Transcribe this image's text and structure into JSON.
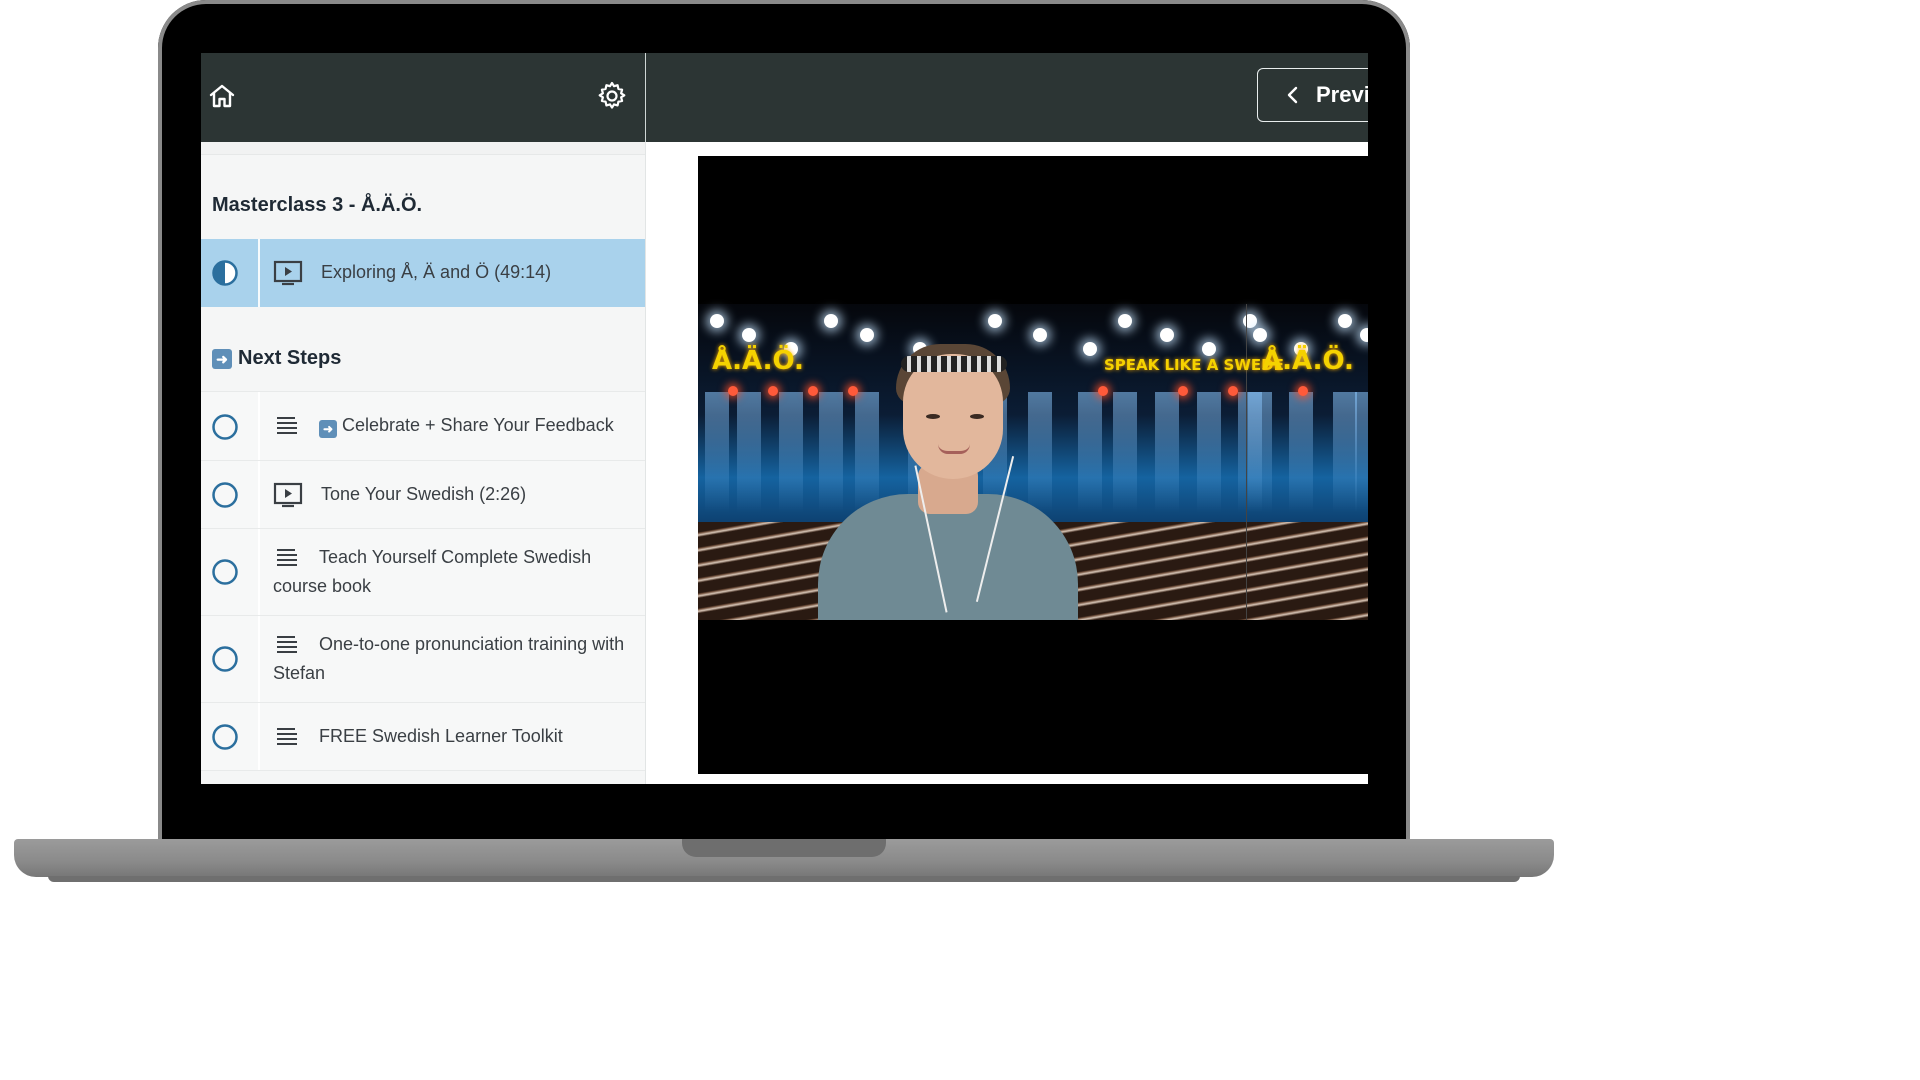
{
  "header": {
    "prev_label": "Previ"
  },
  "sidebar": {
    "section1_title": "Masterclass 3 - Å.Ä.Ö.",
    "section2_title": "Next Steps",
    "lessons": [
      {
        "label": "Exploring Å, Ä and Ö (49:14)",
        "type": "video",
        "status": "in-progress",
        "active": true
      },
      {
        "label": "Celebrate + Share Your Feedback",
        "type": "text",
        "status": "incomplete",
        "prefix_icon": "arrow-right-emoji"
      },
      {
        "label": "Tone Your Swedish (2:26)",
        "type": "video",
        "status": "incomplete"
      },
      {
        "label": "Teach Yourself Complete Swedish course book",
        "type": "text",
        "status": "incomplete"
      },
      {
        "label": "One-to-one pronunciation training with Stefan",
        "type": "text",
        "status": "incomplete"
      },
      {
        "label": "FREE Swedish Learner Toolkit",
        "type": "text",
        "status": "incomplete"
      }
    ]
  },
  "video": {
    "banner_left": "Å.Ä.Ö.",
    "banner_center": "SPEAK LIKE A SWEDE",
    "banner_right": "Å.Ä.Ö."
  },
  "colors": {
    "topbar": "#2c3534",
    "active_lesson": "#a9d2ec",
    "status_ring": "#2b6f9e",
    "banner_text": "#f5d200"
  },
  "icons": [
    "home-icon",
    "gear-icon",
    "chevron-left-icon",
    "video-lesson-icon",
    "text-lesson-icon",
    "half-circle-status-icon",
    "empty-circle-status-icon",
    "arrow-right-emoji-icon"
  ]
}
